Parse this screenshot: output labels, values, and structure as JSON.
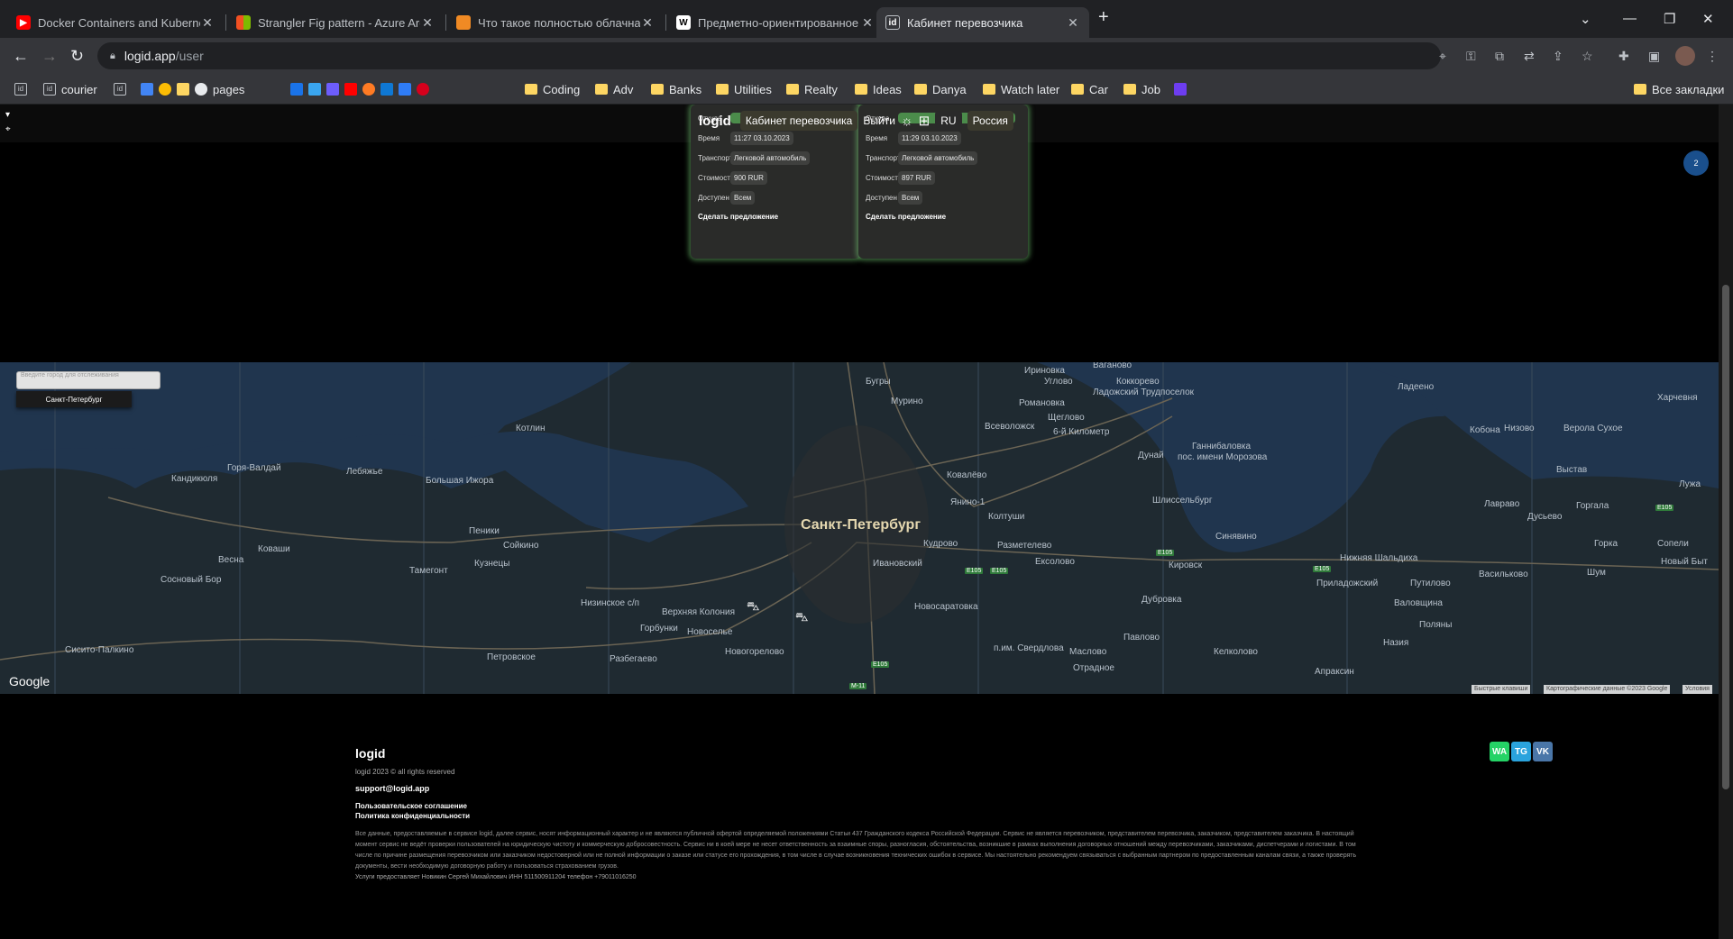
{
  "browser": {
    "tabs": [
      {
        "title": "Docker Containers and Kubernet",
        "favicon": "youtube-icon",
        "color": "#ff0000"
      },
      {
        "title": "Strangler Fig pattern - Azure Arc",
        "favicon": "microsoft-icon",
        "color": "#f25022"
      },
      {
        "title": "Что такое полностью облачная",
        "favicon": "cube-icon",
        "color": "#f08a24"
      },
      {
        "title": "Предметно-ориентированное",
        "favicon": "wikipedia-icon",
        "color": "#ffffff"
      },
      {
        "title": "Кабинет перевозчика",
        "favicon": "id-icon",
        "color": "#bdc1c6",
        "active": true
      }
    ],
    "url": {
      "host": "logid.app",
      "path": "/user"
    },
    "bookmarks": [
      {
        "label": "",
        "icon": "id-icon"
      },
      {
        "label": "courier",
        "icon": "id-icon"
      },
      {
        "label": "",
        "icon": "id-icon"
      },
      {
        "label": "pages",
        "icon": "globe-icon"
      },
      {
        "label": "Coding",
        "icon": "folder-icon"
      },
      {
        "label": "Adv",
        "icon": "folder-icon"
      },
      {
        "label": "Banks",
        "icon": "folder-icon"
      },
      {
        "label": "Utilities",
        "icon": "folder-icon"
      },
      {
        "label": "Realty",
        "icon": "folder-icon"
      },
      {
        "label": "Ideas",
        "icon": "folder-icon"
      },
      {
        "label": "Danya",
        "icon": "folder-icon"
      },
      {
        "label": "Watch later",
        "icon": "folder-icon"
      },
      {
        "label": "Car",
        "icon": "folder-icon"
      },
      {
        "label": "Job",
        "icon": "folder-icon"
      }
    ],
    "all_bookmarks": "Все закладки"
  },
  "header": {
    "brand": "logid",
    "cabinet": "Кабинет перевозчика",
    "logout": "Выйти",
    "lang": "RU",
    "country": "Россия"
  },
  "orders": [
    {
      "from_label": "Откуда",
      "time_label": "Время",
      "time": "11:27 03.10.2023",
      "transport_label": "Транспорт",
      "transport": "Легковой автомобиль",
      "cost_label": "Стоимость",
      "cost": "900 RUR",
      "access_label": "Доступен",
      "access": "Всем",
      "cta": "Сделать предложение"
    },
    {
      "from_label": "Откуда",
      "time_label": "Время",
      "time": "11:29 03.10.2023",
      "transport_label": "Транспорт",
      "transport": "Легковой автомобиль",
      "cost_label": "Стоимость",
      "cost": "897 RUR",
      "access_label": "Доступен",
      "access": "Всем",
      "cta": "Сделать предложение"
    }
  ],
  "notification_count": "2",
  "map": {
    "search_placeholder": "Введите город для отслеживания",
    "selected_city": "Санкт-Петербург",
    "city_label": "Санкт-Петербург",
    "labels": [
      "Ваганово",
      "Ириновка",
      "Коккорево",
      "Ладожский Трудпоселок",
      "Бугры",
      "Углово",
      "Мурино",
      "Романовка",
      "Щеглово",
      "Всеволожск",
      "6-й Километр",
      "Котлин",
      "Ганнибаловка",
      "Дунай",
      "пос. имени Морозова",
      "Кандикюля",
      "Горя-Валдай",
      "Лебяжье",
      "Большая Ижора",
      "Ковалёво",
      "Янино-1",
      "Шлиссельбург",
      "Колтуши",
      "Пеники",
      "Сойкино",
      "Весна",
      "Коваши",
      "Кудрово",
      "Разметелево",
      "Синявино",
      "Сосновый Бор",
      "Тамегонт",
      "Кузнецы",
      "Ивановский",
      "Ексолово",
      "Кировск",
      "Низинское с/п",
      "Верхняя Колония",
      "Горбунки",
      "Новоселье",
      "Новосаратовка",
      "Дубровка",
      "Приладожский",
      "Путилово",
      "Назия",
      "Ладеено",
      "Харчевня",
      "Кобона",
      "Низово",
      "Верола Сухое",
      "Выстав",
      "Лавраво",
      "Горгала",
      "Дусьево",
      "Лужа",
      "Горка",
      "Сопели",
      "Новый Быт",
      "Шум",
      "Васильково",
      "Валовщина",
      "Поляны",
      "Сисито-Палкино",
      "Петровское",
      "Разбегаево",
      "Новогорелово",
      "Павлово",
      "Келколово",
      "Маслово",
      "Отрадное",
      "п.им. Свердлова",
      "Апраксин",
      "Нижняя Шальдиха"
    ],
    "highways": [
      "E105",
      "E105",
      "E105",
      "E105",
      "E105",
      "E105",
      "M-11"
    ],
    "google": "Google",
    "attribution": [
      "Быстрые клавиши",
      "Картографические данные ©2023 Google",
      "Условия"
    ]
  },
  "footer": {
    "brand": "logid",
    "copyright": "logid 2023 © all rights reserved",
    "email": "support@logid.app",
    "terms": "Пользовательское соглашение",
    "privacy": "Политика конфиденциальности",
    "legal": "Все данные, предоставляемые в сервисе logid, далее сервис, носят информационный характер и не являются публичной офертой определяемой положениями Статьи 437 Гражданского кодекса Российской Федерации. Сервис не является перевозчиком, представителем перевозчика, заказчиком, представителем заказчика. В настоящий момент сервис не ведёт проверки пользователей на юридическую чистоту и коммерческую добросовестность. Сервис ни в коей мере не несет ответственность за взаимные споры, разногласия, обстоятельства, возникшие в рамках выполнения договорных отношений между перевозчиками, заказчиками, диспетчерами и логистами. В том числе по причине размещения перевозчиком или заказчиком недостоверной или не полной информации о заказе или статусе его прохождения, в том числе в случае возникновения технических ошибок в сервисе. Мы настоятельно рекомендуем связываться с выбранным партнером по предоставленным каналам связи, а также проверять документы, вести необходимую договорную работу и пользоваться страхованием грузов.",
    "provider": "Услуги предоставляет Новикин Сергей Михайлович ИНН 511500911204 телефон +79011016250",
    "social": [
      "WA",
      "TG",
      "VK"
    ]
  }
}
